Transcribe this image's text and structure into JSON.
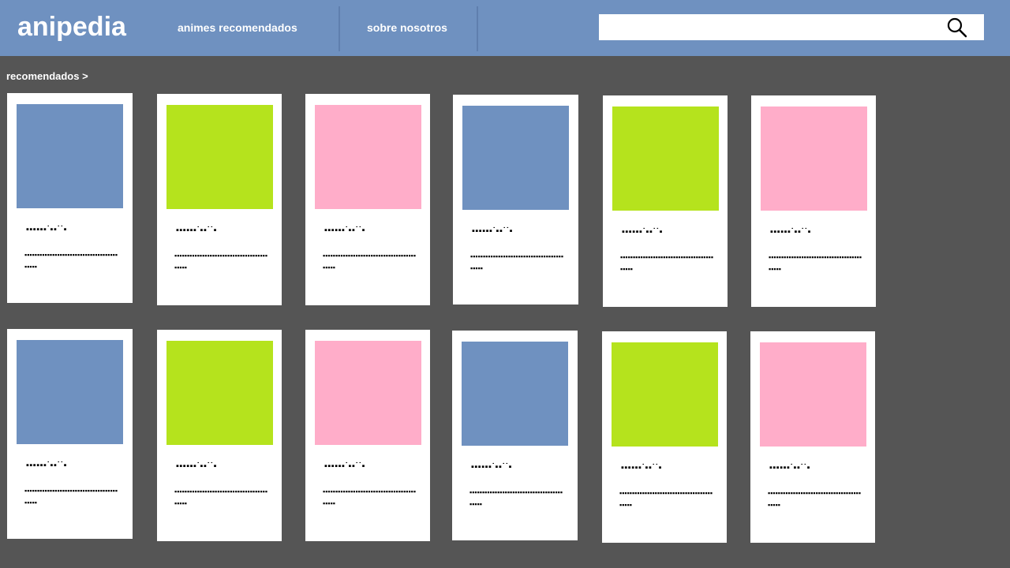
{
  "header": {
    "logo": "anipedia",
    "nav": [
      {
        "label": "animes recomendados"
      },
      {
        "label": "sobre nosotros"
      }
    ],
    "search": {
      "placeholder": "",
      "value": "",
      "icon": "search-icon"
    }
  },
  "section": {
    "title": "recomendados >"
  },
  "colors": {
    "header_bg": "#6f91c0",
    "page_bg": "#555555",
    "blue": "#6f91c0",
    "green": "#b5e31d",
    "pink": "#ffadc9"
  },
  "cards": [
    {
      "color": "blue",
      "title": "▪▪▪▪▪▪˙▪▪˙˙▪",
      "desc": "▪▪▪▪▪▪▪▪▪▪▪▪▪▪▪▪▪▪▪▪▪▪▪▪▪▪▪▪▪▪▪▪▪▪▪▪▪▪▪▪▪▪"
    },
    {
      "color": "green",
      "title": "▪▪▪▪▪▪˙▪▪˙˙▪",
      "desc": "▪▪▪▪▪▪▪▪▪▪▪▪▪▪▪▪▪▪▪▪▪▪▪▪▪▪▪▪▪▪▪▪▪▪▪▪▪▪▪▪▪▪"
    },
    {
      "color": "pink",
      "title": "▪▪▪▪▪▪˙▪▪˙˙▪",
      "desc": "▪▪▪▪▪▪▪▪▪▪▪▪▪▪▪▪▪▪▪▪▪▪▪▪▪▪▪▪▪▪▪▪▪▪▪▪▪▪▪▪▪▪"
    },
    {
      "color": "blue",
      "title": "▪▪▪▪▪▪˙▪▪˙˙▪",
      "desc": "▪▪▪▪▪▪▪▪▪▪▪▪▪▪▪▪▪▪▪▪▪▪▪▪▪▪▪▪▪▪▪▪▪▪▪▪▪▪▪▪▪▪"
    },
    {
      "color": "green",
      "title": "▪▪▪▪▪▪˙▪▪˙˙▪",
      "desc": "▪▪▪▪▪▪▪▪▪▪▪▪▪▪▪▪▪▪▪▪▪▪▪▪▪▪▪▪▪▪▪▪▪▪▪▪▪▪▪▪▪▪"
    },
    {
      "color": "pink",
      "title": "▪▪▪▪▪▪˙▪▪˙˙▪",
      "desc": "▪▪▪▪▪▪▪▪▪▪▪▪▪▪▪▪▪▪▪▪▪▪▪▪▪▪▪▪▪▪▪▪▪▪▪▪▪▪▪▪▪▪"
    },
    {
      "color": "blue",
      "title": "▪▪▪▪▪▪˙▪▪˙˙▪",
      "desc": "▪▪▪▪▪▪▪▪▪▪▪▪▪▪▪▪▪▪▪▪▪▪▪▪▪▪▪▪▪▪▪▪▪▪▪▪▪▪▪▪▪▪"
    },
    {
      "color": "green",
      "title": "▪▪▪▪▪▪˙▪▪˙˙▪",
      "desc": "▪▪▪▪▪▪▪▪▪▪▪▪▪▪▪▪▪▪▪▪▪▪▪▪▪▪▪▪▪▪▪▪▪▪▪▪▪▪▪▪▪▪"
    },
    {
      "color": "pink",
      "title": "▪▪▪▪▪▪˙▪▪˙˙▪",
      "desc": "▪▪▪▪▪▪▪▪▪▪▪▪▪▪▪▪▪▪▪▪▪▪▪▪▪▪▪▪▪▪▪▪▪▪▪▪▪▪▪▪▪▪"
    },
    {
      "color": "blue",
      "title": "▪▪▪▪▪▪˙▪▪˙˙▪",
      "desc": "▪▪▪▪▪▪▪▪▪▪▪▪▪▪▪▪▪▪▪▪▪▪▪▪▪▪▪▪▪▪▪▪▪▪▪▪▪▪▪▪▪▪"
    },
    {
      "color": "green",
      "title": "▪▪▪▪▪▪˙▪▪˙˙▪",
      "desc": "▪▪▪▪▪▪▪▪▪▪▪▪▪▪▪▪▪▪▪▪▪▪▪▪▪▪▪▪▪▪▪▪▪▪▪▪▪▪▪▪▪▪"
    },
    {
      "color": "pink",
      "title": "▪▪▪▪▪▪˙▪▪˙˙▪",
      "desc": "▪▪▪▪▪▪▪▪▪▪▪▪▪▪▪▪▪▪▪▪▪▪▪▪▪▪▪▪▪▪▪▪▪▪▪▪▪▪▪▪▪▪"
    }
  ]
}
